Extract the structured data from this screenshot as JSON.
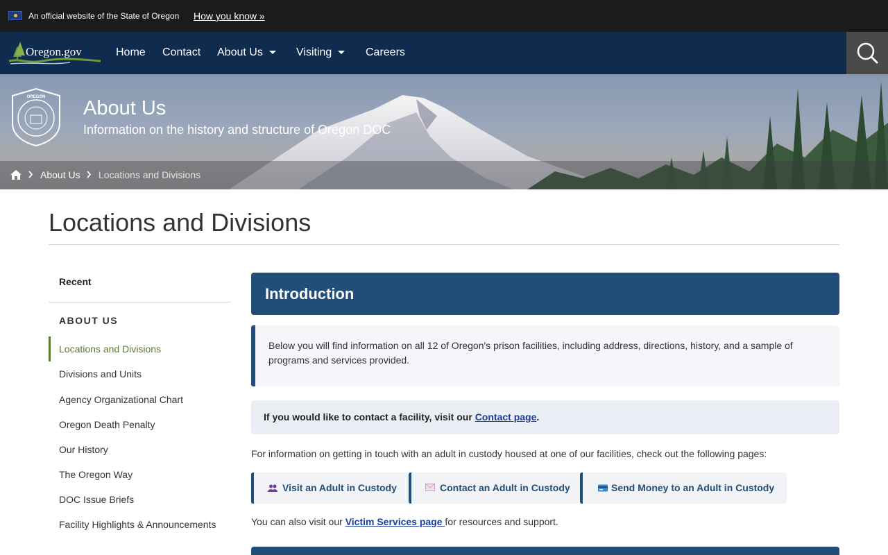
{
  "official_banner": {
    "text": "An official website of the State of Oregon",
    "how_link": "How you know »"
  },
  "nav": {
    "logo_text": "Oregon.gov",
    "items": [
      {
        "label": "Home",
        "dropdown": false
      },
      {
        "label": "Contact",
        "dropdown": false
      },
      {
        "label": "About Us",
        "dropdown": true
      },
      {
        "label": "Visiting",
        "dropdown": true
      },
      {
        "label": "Careers",
        "dropdown": false
      }
    ],
    "search_icon": "search-icon"
  },
  "hero": {
    "title": "About Us",
    "subtitle": "Information on the history and structure of Oregon DOC",
    "seal_text": "Oregon Department of Corrections"
  },
  "breadcrumb": {
    "home_icon": "home-icon",
    "items": [
      {
        "label": "About Us"
      },
      {
        "label": "Locations and Divisions"
      }
    ]
  },
  "page": {
    "title": "Locations and Divisions"
  },
  "sidebar": {
    "recent": "Recent",
    "heading": "ABOUT US",
    "items": [
      {
        "label": "Locations and Divisions",
        "active": true
      },
      {
        "label": "Divisions and Units"
      },
      {
        "label": "Agency Organizational Chart"
      },
      {
        "label": "Oregon Death Penalty"
      },
      {
        "label": "Our History"
      },
      {
        "label": "The Oregon Way"
      },
      {
        "label": "DOC Issue Briefs"
      },
      {
        "label": "Facility Highlights & Announcements"
      }
    ]
  },
  "main": {
    "intro_heading": "Introduction",
    "intro_text": "Below you will find information on all 12 of Oregon's prison facilities, including address, directions, history, and a sample of programs and services provided.",
    "contact_prefix": "If you would like to contact a facility, visit our ",
    "contact_link": "Contact page",
    "contact_suffix": ".",
    "info_text": "For information on getting in touch with an adult in custody housed at one of our facilities, check out the following pages:",
    "pills": [
      {
        "label": "Visit an Adult in Custody",
        "icon": "people-icon"
      },
      {
        "label": "Contact an Adult in Custody",
        "icon": "envelope-icon"
      },
      {
        "label": "Send Money to an Adult in Custody",
        "icon": "card-icon"
      }
    ],
    "victim_prefix": "You can also visit our ",
    "victim_link": "Victim Services page ",
    "victim_suffix": "for resources and support."
  },
  "colors": {
    "nav_bg": "#0f2b4e",
    "accent_blue": "#214e79",
    "active_green": "#5c7a2f",
    "link_blue": "#1a3d9c"
  }
}
